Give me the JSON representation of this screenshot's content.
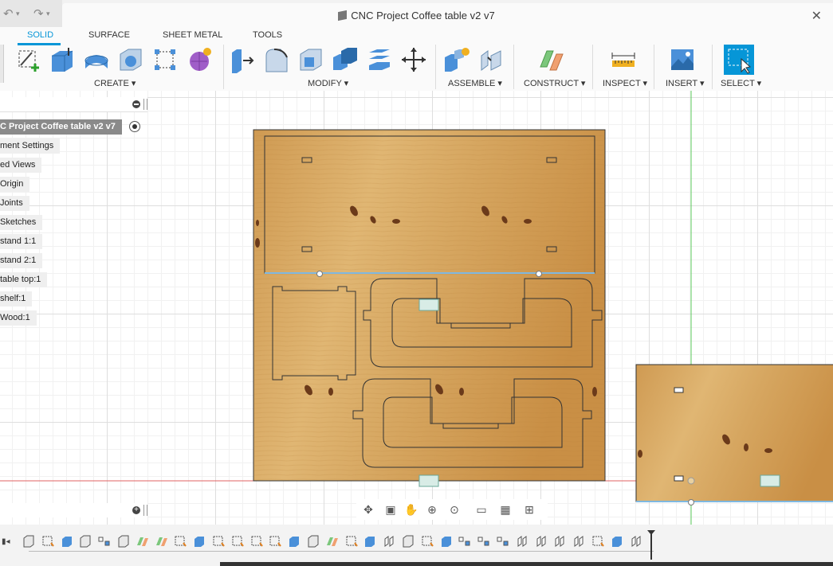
{
  "title_bar": {
    "document_title": "CNC Project  Coffee table v2 v7",
    "undo_icon": "undo-icon",
    "redo_icon": "redo-icon",
    "close_label": "✕"
  },
  "ribbon": {
    "tabs": [
      {
        "label": "SOLID",
        "active": true
      },
      {
        "label": "SURFACE",
        "active": false
      },
      {
        "label": "SHEET METAL",
        "active": false
      },
      {
        "label": "TOOLS",
        "active": false
      }
    ],
    "groups": [
      {
        "label": "CREATE ▾"
      },
      {
        "label": "MODIFY ▾"
      },
      {
        "label": "ASSEMBLE ▾"
      },
      {
        "label": "CONSTRUCT ▾"
      },
      {
        "label": "INSPECT ▾"
      },
      {
        "label": "INSERT ▾"
      },
      {
        "label": "SELECT ▾"
      }
    ],
    "accent": "#0696d7"
  },
  "browser": {
    "root": "C Project  Coffee table v2 v7",
    "items": [
      "ment Settings",
      "ed Views",
      "Origin",
      "Joints",
      "Sketches",
      "stand 1:1",
      "stand 2:1",
      "table top:1",
      "shelf:1",
      "Wood:1"
    ]
  },
  "nav_bar": {
    "icons": [
      "orbit-icon",
      "look-at-icon",
      "pan-icon",
      "zoom-icon",
      "fit-icon",
      "display-settings-icon",
      "grid-icon",
      "viewports-icon"
    ]
  },
  "colors": {
    "wood": "#d9a65e",
    "grid": "#dedede",
    "axis_green": "#5ac85a",
    "axis_red": "#e06060",
    "selection_blue": "#0696d7"
  }
}
